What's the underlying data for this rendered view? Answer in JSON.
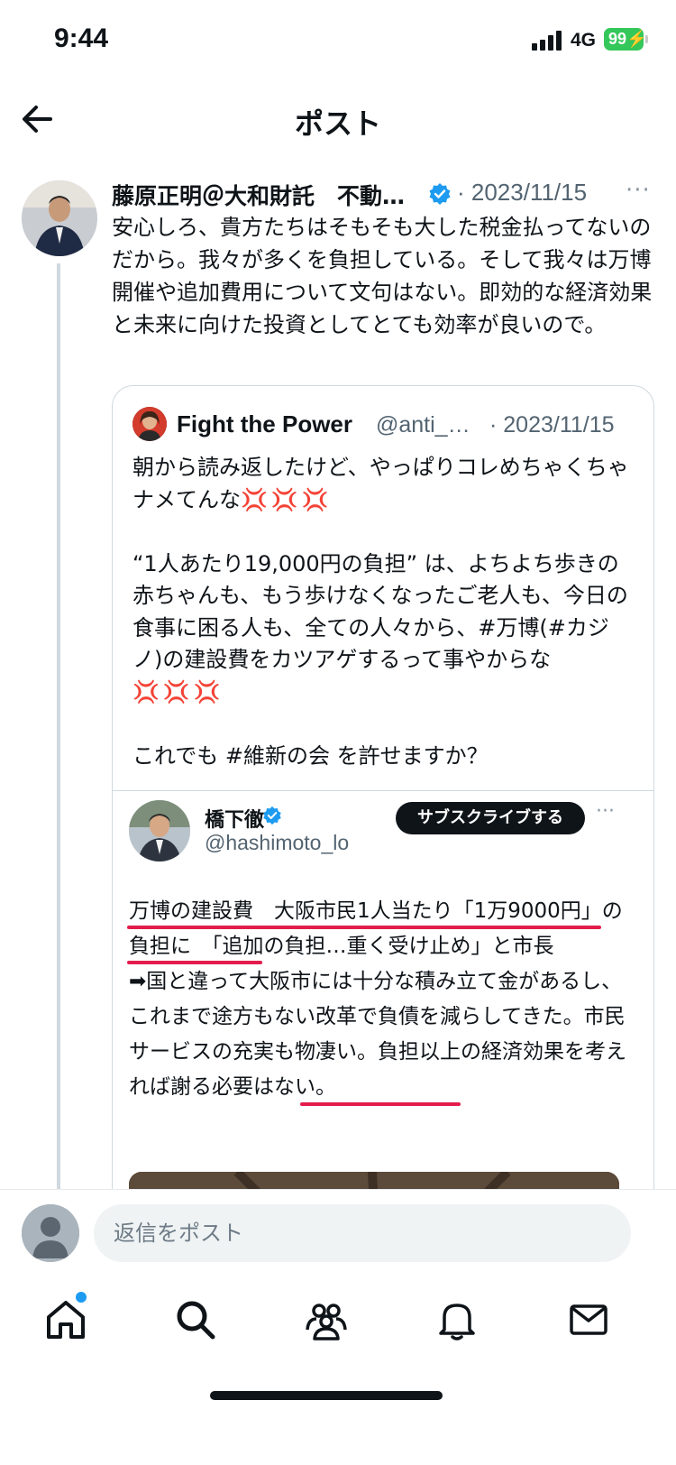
{
  "status": {
    "time": "9:44",
    "network": "4G",
    "battery": "99"
  },
  "header": {
    "title": "ポスト"
  },
  "tweet": {
    "author": "藤原正明＠大和財託　不動…",
    "date": "· 2023/11/15",
    "more": "···",
    "text": "安心しろ、貴方たちはそもそも大した税金払ってないのだから。我々が多くを負担している。そして我々は万博開催や追加費用について文句はない。即効的な経済効果と未来に向けた投資としてとても効率が良いので。"
  },
  "quote": {
    "name": "Fight the Power",
    "handle": "@anti_…",
    "date": "· 2023/11/15",
    "text_1": "朝から読み返したけど、やっぱりコレめちゃくちゃナメてんな",
    "emoji_1": "💢💢💢",
    "text_2": "\n\n“1人あたり19,000円の負担” は、よちよち歩きの赤ちゃんも、もう歩けなくなったご老人も、今日の食事に困る人も、全ての人々から、#万博(#カジノ)の建設費をカツアゲするって事やからな",
    "emoji_2": "💢💢💢",
    "text_3": "\n\nこれでも #維新の会 を許せますか？"
  },
  "embed": {
    "name": "橋下徹",
    "handle": "@hashimoto_lo",
    "subscribe": "サブスクライブする",
    "more": "···",
    "text": "万博の建設費　大阪市民1人当たり「1万9000円」の負担に　「追加の負担…重く受け止め」と市長\n➡国と違って大阪市には十分な積み立て金があるし、これまで途方もない改革で負債を減らしてきた。市民サービスの充実も物凄い。負担以上の経済効果を考えれば謝る必要はない。"
  },
  "reply": {
    "placeholder": "返信をポスト"
  },
  "tabs": {
    "home": "home-icon",
    "search": "search-icon",
    "communities": "communities-icon",
    "notifications": "bell-icon",
    "messages": "mail-icon"
  },
  "colors": {
    "accent": "#1d9bf0",
    "anger": "#e0245e",
    "underline": "#e31c4c",
    "battery": "#34c759"
  }
}
